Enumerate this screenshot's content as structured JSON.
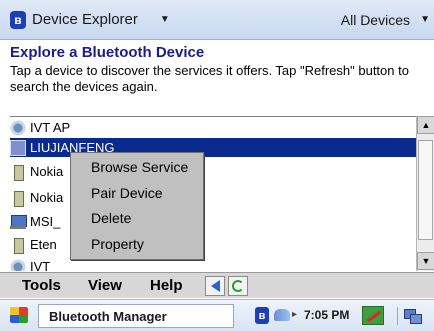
{
  "titlebar": {
    "app_icon": "bluetooth-icon",
    "title": "Device Explorer",
    "caret": "▼",
    "filter_label": "All Devices",
    "filter_caret": "▼"
  },
  "header": {
    "title": "Explore a Bluetooth Device",
    "description": "Tap a device to discover the services it offers. Tap \"Refresh\" button to search the devices again."
  },
  "devices": [
    {
      "label": "IVT AP",
      "icon": "access-point-icon",
      "selected": false
    },
    {
      "label": "LIUJIANFENG",
      "icon": "computer-icon",
      "selected": true
    },
    {
      "label": "Nokia",
      "icon": "phone-icon",
      "selected": false
    },
    {
      "label": "Nokia",
      "icon": "phone-icon",
      "selected": false
    },
    {
      "label": "MSI_",
      "icon": "computer-icon",
      "selected": false
    },
    {
      "label": "Eten",
      "icon": "phone-icon",
      "selected": false
    },
    {
      "label": "IVT",
      "icon": "access-point-icon",
      "selected": false
    }
  ],
  "context_menu": {
    "items": [
      "Browse Service",
      "Pair Device",
      "Delete",
      "Property"
    ]
  },
  "menubar": {
    "items": [
      "Tools",
      "View",
      "Help"
    ],
    "back_icon": "back-arrow-icon",
    "refresh_icon": "refresh-icon"
  },
  "taskbar": {
    "start_icon": "windows-flag-icon",
    "task_label": "Bluetooth Manager",
    "tray": {
      "time": "7:05 PM",
      "icons": [
        "bluetooth-icon",
        "sync-icon",
        "wireless-icon",
        "network-icon"
      ]
    }
  },
  "colors": {
    "selection": "#0a2a8f",
    "header_title": "#1c1c8c",
    "menu_bg": "#c0c0c0"
  }
}
